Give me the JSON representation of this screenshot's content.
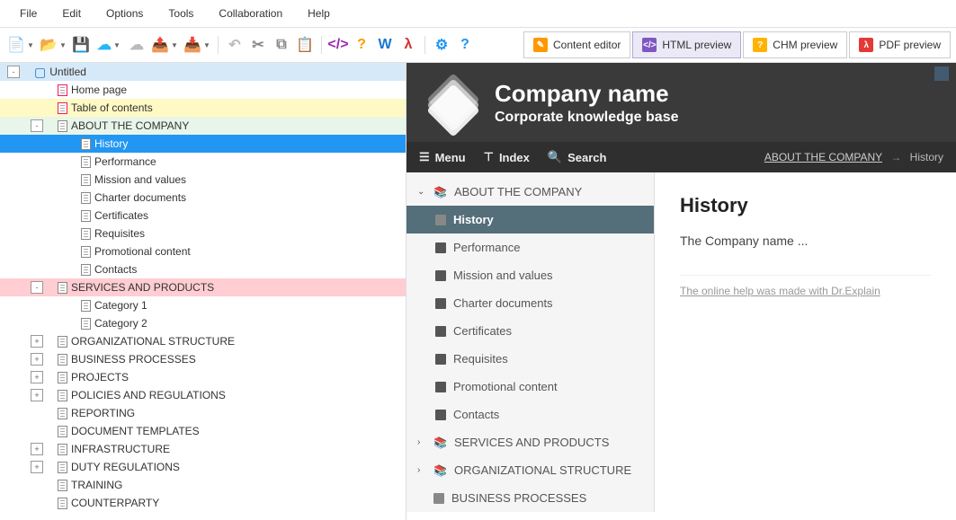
{
  "menubar": [
    "File",
    "Edit",
    "Options",
    "Tools",
    "Collaboration",
    "Help"
  ],
  "toolbar_icons": [
    {
      "name": "new-file-icon",
      "glyph": "📄",
      "color": "#2196f3",
      "dd": true
    },
    {
      "name": "open-file-icon",
      "glyph": "📂",
      "color": "#1976d2",
      "dd": true
    },
    {
      "name": "save-icon",
      "glyph": "💾",
      "color": "#1976d2"
    },
    {
      "name": "cloud-upload-icon",
      "glyph": "☁",
      "color": "#29b6f6",
      "dd": true
    },
    {
      "name": "cloud-icon",
      "glyph": "☁",
      "color": "#bbb"
    },
    {
      "name": "export-icon",
      "glyph": "📤",
      "color": "#4caf50",
      "dd": true
    },
    {
      "name": "export-alt-icon",
      "glyph": "📥",
      "color": "#4caf50",
      "dd": true
    },
    {
      "name": "sep"
    },
    {
      "name": "undo-icon",
      "glyph": "↶",
      "color": "#bbb"
    },
    {
      "name": "cut-icon",
      "glyph": "✂",
      "color": "#888"
    },
    {
      "name": "copy-icon",
      "glyph": "⧉",
      "color": "#888"
    },
    {
      "name": "paste-icon",
      "glyph": "📋",
      "color": "#888"
    },
    {
      "name": "sep"
    },
    {
      "name": "code-icon",
      "glyph": "</>",
      "color": "#9c27b0"
    },
    {
      "name": "help-icon",
      "glyph": "?",
      "color": "#ff9800"
    },
    {
      "name": "word-icon",
      "glyph": "W",
      "color": "#1976d2"
    },
    {
      "name": "pdf-icon",
      "glyph": "λ",
      "color": "#d32f2f"
    },
    {
      "name": "sep"
    },
    {
      "name": "settings-icon",
      "glyph": "⚙",
      "color": "#2196f3"
    },
    {
      "name": "about-icon",
      "glyph": "?",
      "color": "#2196f3"
    }
  ],
  "preview_tabs": [
    {
      "name": "content-editor-tab",
      "label": "Content editor",
      "icon_color": "#ff9800",
      "active": false,
      "glyph": "✎"
    },
    {
      "name": "html-preview-tab",
      "label": "HTML preview",
      "icon_color": "#7e57c2",
      "active": true,
      "glyph": "</>"
    },
    {
      "name": "chm-preview-tab",
      "label": "CHM preview",
      "icon_color": "#ffb300",
      "active": false,
      "glyph": "?"
    },
    {
      "name": "pdf-preview-tab",
      "label": "PDF preview",
      "icon_color": "#e53935",
      "active": false,
      "glyph": "λ"
    }
  ],
  "tree": [
    {
      "depth": 0,
      "label": "Untitled",
      "toggle": "-",
      "cls": "root",
      "icon": "book"
    },
    {
      "depth": 1,
      "label": "Home page",
      "icon": "home",
      "pink": true
    },
    {
      "depth": 1,
      "label": "Table of contents",
      "icon": "doc",
      "cls": "highlight-yellow",
      "pink": true
    },
    {
      "depth": 1,
      "label": "ABOUT THE COMPANY",
      "toggle": "-",
      "icon": "doc",
      "cls": "highlight-green"
    },
    {
      "depth": 2,
      "label": "History",
      "icon": "doc",
      "cls": "selected"
    },
    {
      "depth": 2,
      "label": "Performance",
      "icon": "doc"
    },
    {
      "depth": 2,
      "label": "Mission and values",
      "icon": "doc"
    },
    {
      "depth": 2,
      "label": "Charter documents",
      "icon": "doc"
    },
    {
      "depth": 2,
      "label": "Certificates",
      "icon": "doc"
    },
    {
      "depth": 2,
      "label": "Requisites",
      "icon": "doc"
    },
    {
      "depth": 2,
      "label": "Promotional content",
      "icon": "doc"
    },
    {
      "depth": 2,
      "label": "Contacts",
      "icon": "doc"
    },
    {
      "depth": 1,
      "label": "SERVICES AND PRODUCTS",
      "toggle": "-",
      "icon": "doc",
      "cls": "highlight-red"
    },
    {
      "depth": 2,
      "label": "Category 1",
      "icon": "doc"
    },
    {
      "depth": 2,
      "label": "Category 2",
      "icon": "doc"
    },
    {
      "depth": 1,
      "label": "ORGANIZATIONAL STRUCTURE",
      "toggle": "+",
      "icon": "doc"
    },
    {
      "depth": 1,
      "label": "BUSINESS PROCESSES",
      "toggle": "+",
      "icon": "doc"
    },
    {
      "depth": 1,
      "label": "PROJECTS",
      "toggle": "+",
      "icon": "doc"
    },
    {
      "depth": 1,
      "label": "POLICIES AND REGULATIONS",
      "toggle": "+",
      "icon": "doc"
    },
    {
      "depth": 1,
      "label": "REPORTING",
      "icon": "doc"
    },
    {
      "depth": 1,
      "label": "DOCUMENT TEMPLATES",
      "icon": "doc"
    },
    {
      "depth": 1,
      "label": "INFRASTRUCTURE",
      "toggle": "+",
      "icon": "doc"
    },
    {
      "depth": 1,
      "label": "DUTY REGULATIONS",
      "toggle": "+",
      "icon": "doc"
    },
    {
      "depth": 1,
      "label": "TRAINING",
      "icon": "doc"
    },
    {
      "depth": 1,
      "label": "COUNTERPARTY",
      "icon": "doc"
    }
  ],
  "preview": {
    "title": "Company name",
    "subtitle": "Corporate knowledge base",
    "nav": {
      "menu": "Menu",
      "index": "Index",
      "search": "Search"
    },
    "breadcrumb": {
      "parent": "ABOUT THE COMPANY",
      "current": "History"
    },
    "sidebar": [
      {
        "label": "ABOUT THE COMPANY",
        "type": "section",
        "expanded": true
      },
      {
        "label": "History",
        "type": "child",
        "active": true
      },
      {
        "label": "Performance",
        "type": "child"
      },
      {
        "label": "Mission and values",
        "type": "child"
      },
      {
        "label": "Charter documents",
        "type": "child"
      },
      {
        "label": "Certificates",
        "type": "child"
      },
      {
        "label": "Requisites",
        "type": "child"
      },
      {
        "label": "Promotional content",
        "type": "child"
      },
      {
        "label": "Contacts",
        "type": "child"
      },
      {
        "label": "SERVICES AND PRODUCTS",
        "type": "section",
        "expanded": false
      },
      {
        "label": "ORGANIZATIONAL STRUCTURE",
        "type": "section",
        "expanded": false
      },
      {
        "label": "BUSINESS PROCESSES",
        "type": "section-plain"
      }
    ],
    "content": {
      "heading": "History",
      "body": "The Company name ...",
      "footer": "The online help was made with Dr.Explain"
    }
  }
}
